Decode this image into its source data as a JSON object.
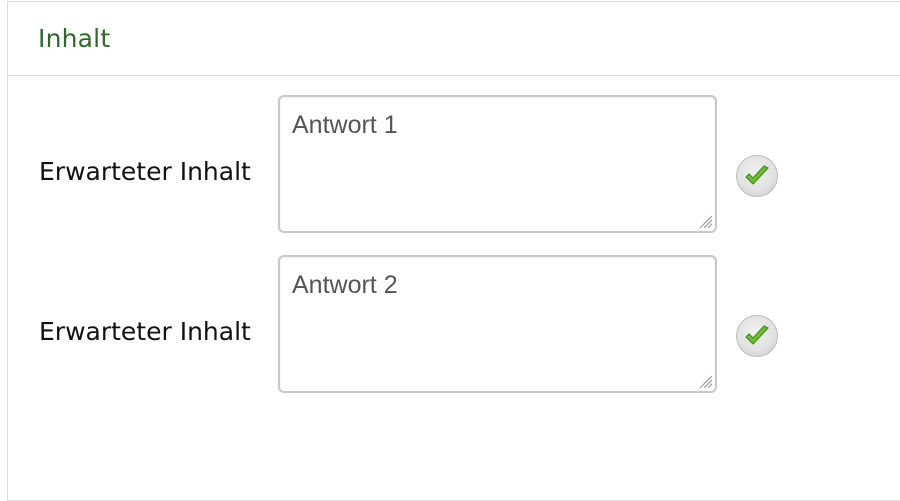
{
  "panel": {
    "title": "Inhalt"
  },
  "rows": [
    {
      "label": "Erwarteter Inhalt",
      "answer": "Antwort 1",
      "check_icon": "check-icon"
    },
    {
      "label": "Erwarteter Inhalt",
      "answer": "Antwort 2",
      "check_icon": "check-icon"
    }
  ],
  "colors": {
    "title": "#2e6a2b",
    "check": "#6cc02c"
  }
}
